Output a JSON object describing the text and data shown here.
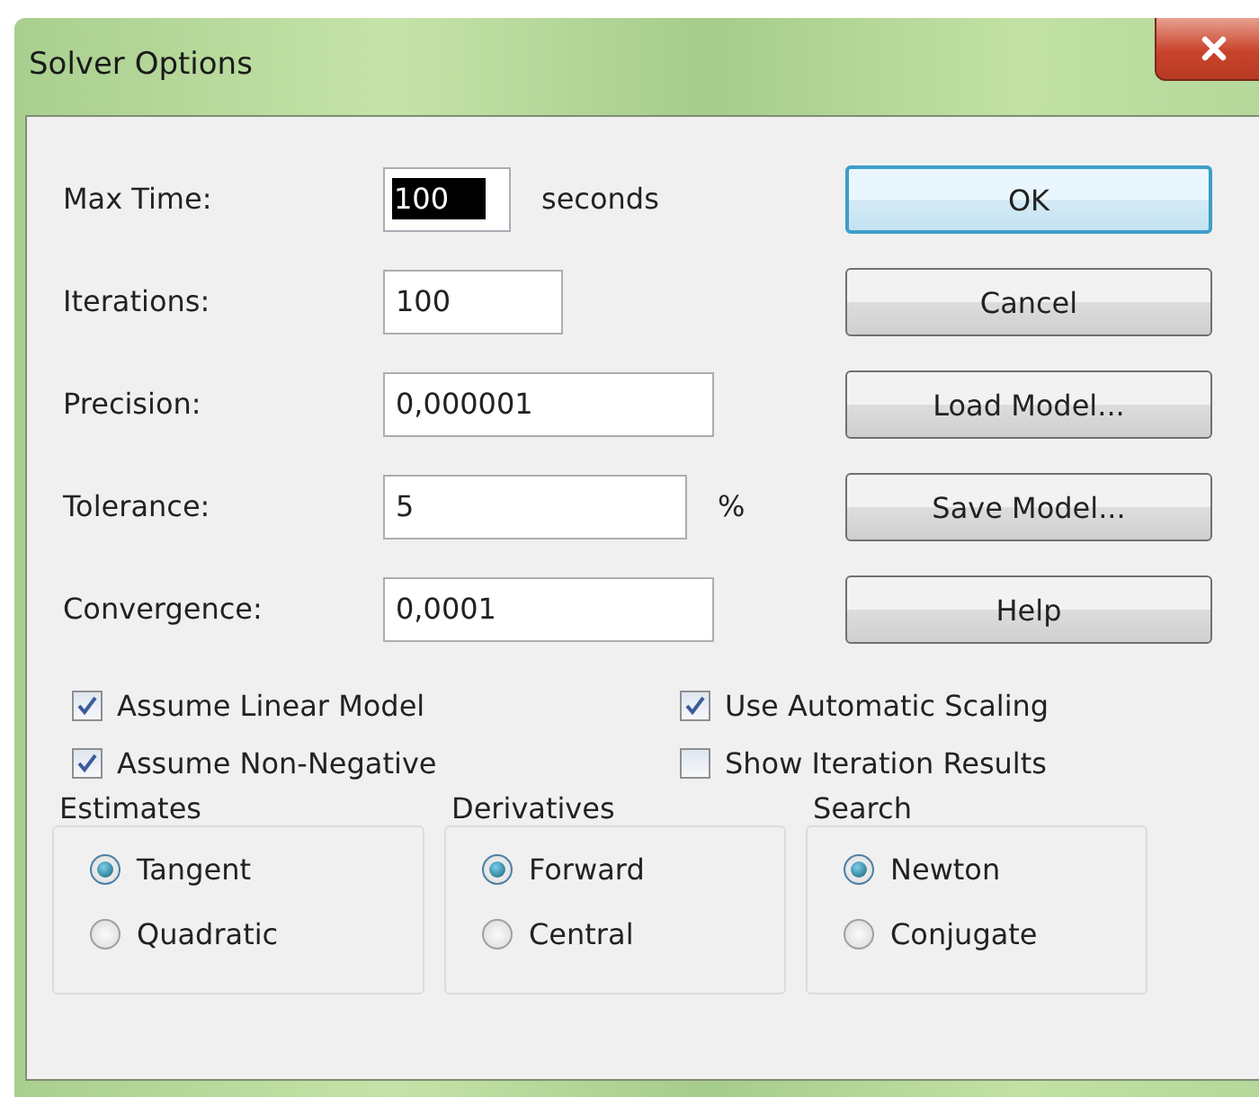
{
  "window": {
    "title": "Solver Options"
  },
  "fields": [
    {
      "label": "Max Time:",
      "value": "100",
      "selected": true,
      "suffix": "seconds"
    },
    {
      "label": "Iterations:",
      "value": "100",
      "selected": false
    },
    {
      "label": "Precision:",
      "value": "0,000001",
      "selected": false
    },
    {
      "label": "Tolerance:",
      "value": "5",
      "selected": false,
      "suffix": "%"
    },
    {
      "label": "Convergence:",
      "value": "0,0001",
      "selected": false
    }
  ],
  "buttons": [
    {
      "label": "OK",
      "default": true
    },
    {
      "label": "Cancel",
      "default": false
    },
    {
      "label": "Load Model...",
      "default": false
    },
    {
      "label": "Save Model...",
      "default": false
    },
    {
      "label": "Help",
      "default": false
    }
  ],
  "checkboxes": [
    {
      "label": "Assume Linear Model",
      "checked": true
    },
    {
      "label": "Use Automatic Scaling",
      "checked": true
    },
    {
      "label": "Assume Non-Negative",
      "checked": true
    },
    {
      "label": "Show Iteration Results",
      "checked": false
    }
  ],
  "groups": [
    {
      "title": "Estimates",
      "options": [
        {
          "label": "Tangent",
          "selected": true
        },
        {
          "label": "Quadratic",
          "selected": false
        }
      ]
    },
    {
      "title": "Derivatives",
      "options": [
        {
          "label": "Forward",
          "selected": true
        },
        {
          "label": "Central",
          "selected": false
        }
      ]
    },
    {
      "title": "Search",
      "options": [
        {
          "label": "Newton",
          "selected": true
        },
        {
          "label": "Conjugate",
          "selected": false
        }
      ]
    }
  ]
}
